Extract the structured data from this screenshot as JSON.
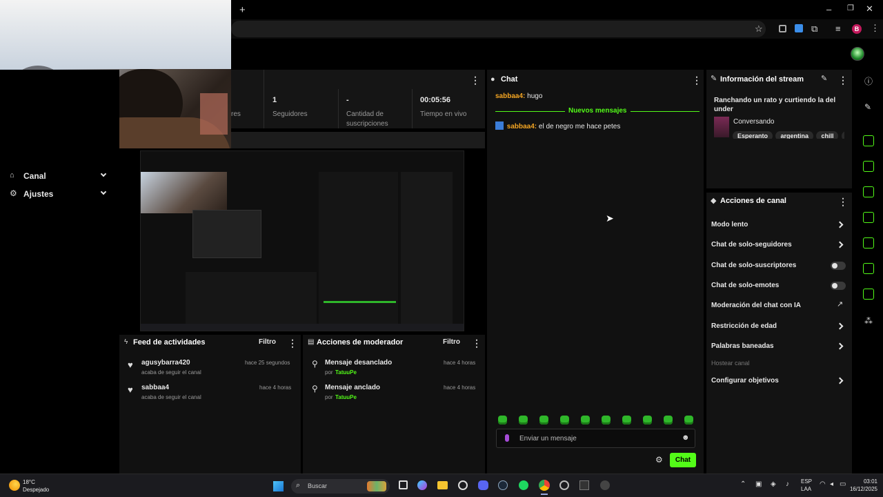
{
  "stats": {
    "followers_partial": "res",
    "followers_value": "1",
    "followers_label": "Seguidores",
    "subs_value": "-",
    "subs_label_1": "Cantidad de",
    "subs_label_2": "suscripciones",
    "live_value": "00:05:56",
    "live_label": "Tiempo en vivo"
  },
  "sidebar": {
    "canal": "Canal",
    "ajustes": "Ajustes"
  },
  "chat": {
    "title": "Chat",
    "msg1_user": "sabbaa4:",
    "msg1_text": "hugo",
    "new_messages": "Nuevos mensajes",
    "msg2_user": "sabbaa4:",
    "msg2_text": "el de negro me hace petes",
    "input_placeholder": "Enviar un mensaje",
    "send_label": "Chat"
  },
  "info": {
    "title": "Información del stream",
    "stream_title": "Ranchando un rato y curtiendo la del under",
    "category": "Conversando",
    "tags": [
      "Esperanto",
      "argentina",
      "chill",
      "unde"
    ]
  },
  "actions": {
    "title": "Acciones de canal",
    "items": [
      {
        "label": "Modo lento",
        "control": "chevron"
      },
      {
        "label": "Chat de solo-seguidores",
        "control": "chevron"
      },
      {
        "label": "Chat de solo-suscriptores",
        "control": "toggle"
      },
      {
        "label": "Chat de solo-emotes",
        "control": "toggle"
      },
      {
        "label": "Moderación del chat con IA",
        "control": "external"
      },
      {
        "label": "Restricción de edad",
        "control": "chevron"
      },
      {
        "label": "Palabras baneadas",
        "control": "chevron"
      },
      {
        "label": "Hostear canal",
        "control": "disabled"
      },
      {
        "label": "Configurar objetivos",
        "control": "chevron"
      }
    ]
  },
  "feed": {
    "title": "Feed de actividades",
    "filter": "Filtro",
    "items": [
      {
        "user": "agusybarra420",
        "time": "hace 25 segundos",
        "detail": "acaba de seguir el canal"
      },
      {
        "user": "sabbaa4",
        "time": "hace 4 horas",
        "detail": "acaba de seguir el canal"
      }
    ]
  },
  "mod": {
    "title": "Acciones de moderador",
    "filter": "Filtro",
    "items": [
      {
        "action": "Mensaje desanclado",
        "time": "hace 4 horas",
        "by_prefix": "por",
        "by": "TatuuPe"
      },
      {
        "action": "Mensaje anclado",
        "time": "hace 4 horas",
        "by_prefix": "por",
        "by": "TatuuPe"
      }
    ]
  },
  "taskbar": {
    "temp": "18°C",
    "weather": "Despejado",
    "search": "Buscar",
    "lang1": "ESP",
    "lang2": "LAA",
    "time": "03:01",
    "date": "16/12/2025"
  },
  "browser": {
    "profile_initial": "B"
  },
  "colors": {
    "accent": "#53fc18",
    "panel": "#131313",
    "username": "#f5a623"
  }
}
